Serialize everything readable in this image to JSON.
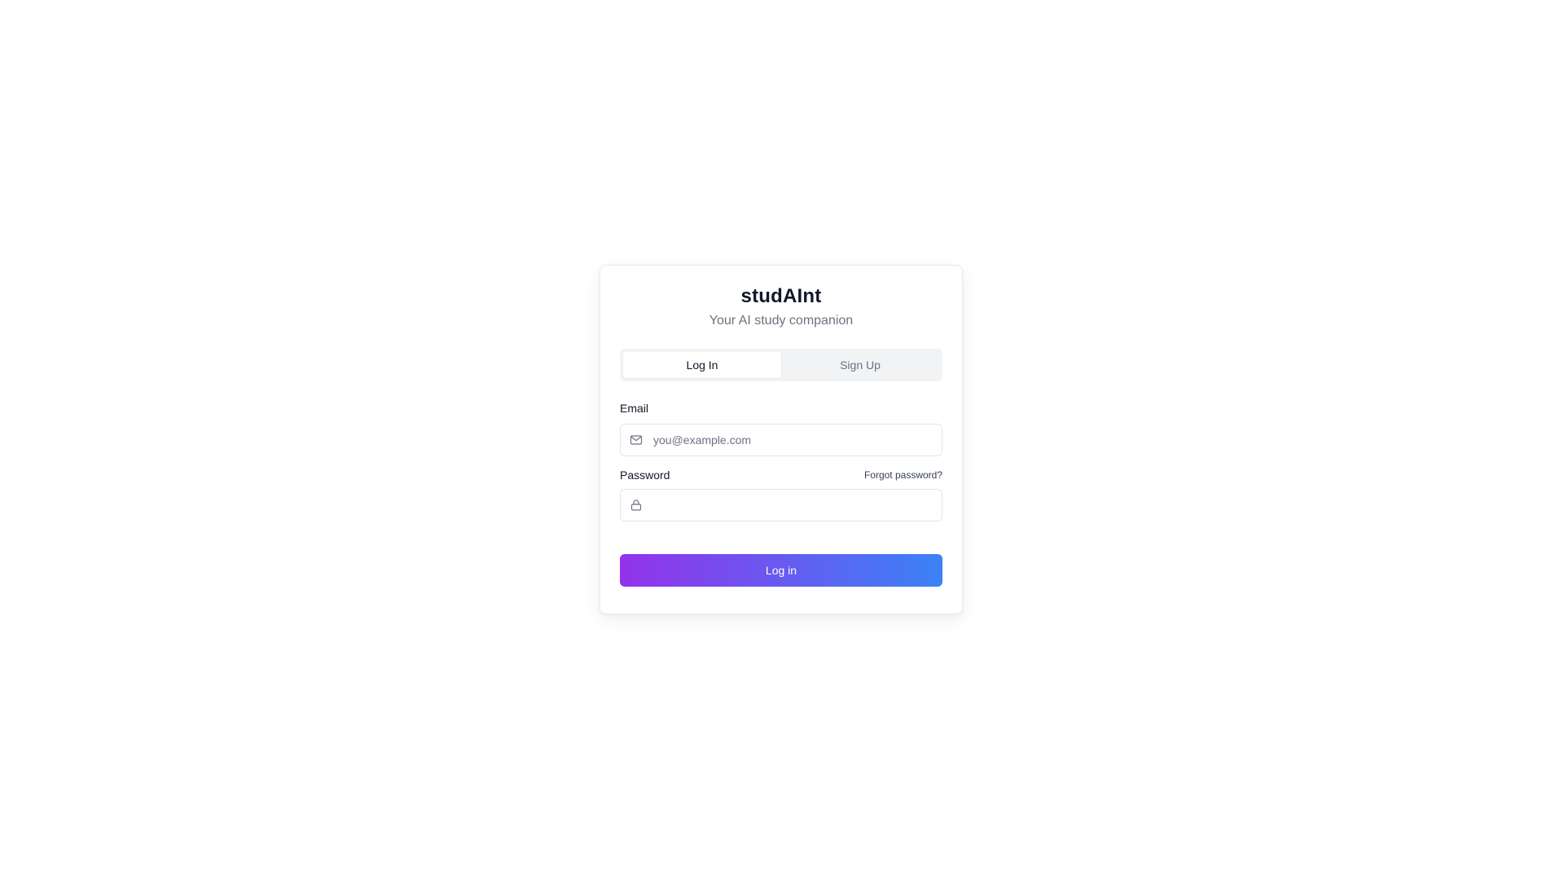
{
  "app": {
    "title": "studAInt",
    "subtitle": "Your AI study companion"
  },
  "tabs": [
    {
      "label": "Log In",
      "active": true
    },
    {
      "label": "Sign Up",
      "active": false
    }
  ],
  "form": {
    "email": {
      "label": "Email",
      "placeholder": "you@example.com",
      "value": "",
      "icon": "mail-icon"
    },
    "password": {
      "label": "Password",
      "placeholder": "",
      "value": "",
      "icon": "lock-icon",
      "forgot_label": "Forgot password?"
    },
    "submit_label": "Log in"
  },
  "colors": {
    "gradient_start": "#9333ea",
    "gradient_end": "#3b82f6",
    "muted_text": "#6b7280",
    "tab_background": "#f1f3f5"
  }
}
